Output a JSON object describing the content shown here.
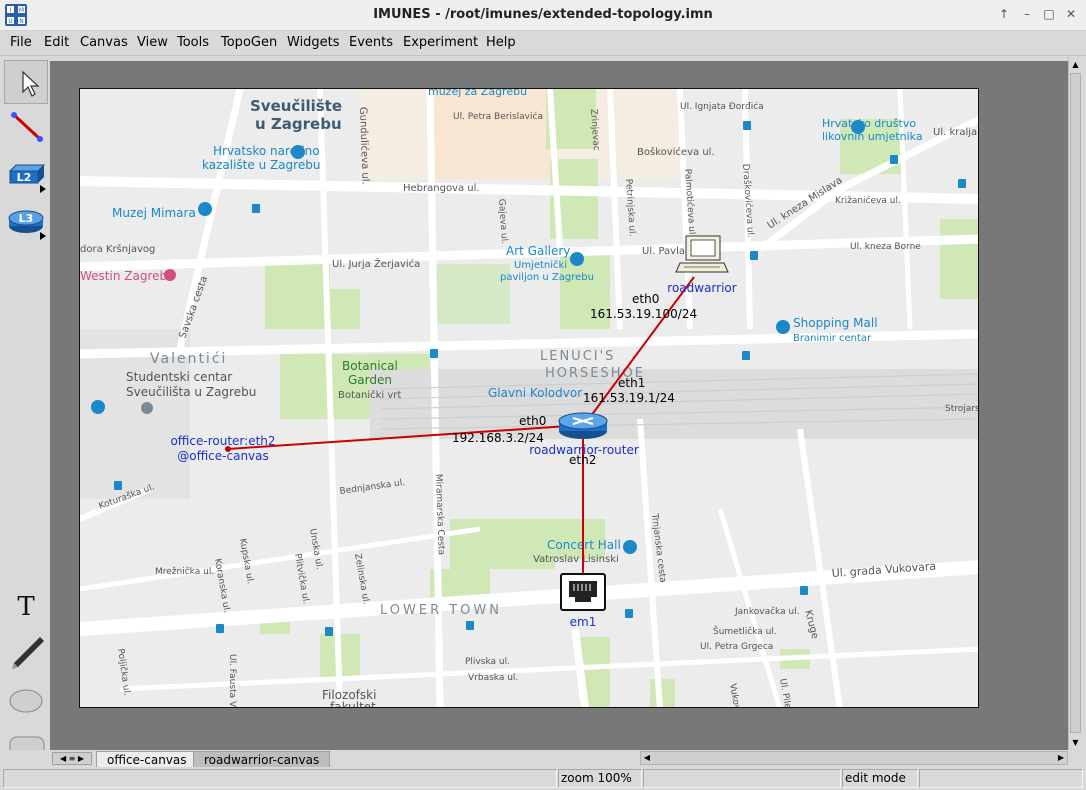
{
  "window": {
    "title": "IMUNES - /root/imunes/extended-topology.imn",
    "app_icon": "imunes-logo-icon",
    "controls": [
      "up-icon",
      "restore-icon",
      "maximize-icon",
      "close-icon"
    ]
  },
  "menubar": {
    "items": [
      {
        "label": "File"
      },
      {
        "label": "Edit"
      },
      {
        "label": "Canvas"
      },
      {
        "label": "View"
      },
      {
        "label": "Tools"
      },
      {
        "label": "TopoGen"
      },
      {
        "label": "Widgets"
      },
      {
        "label": "Events"
      },
      {
        "label": "Experiment"
      },
      {
        "label": "Help"
      }
    ]
  },
  "toolbar": {
    "tools": [
      {
        "name": "select-tool",
        "icon": "pointer-icon"
      },
      {
        "name": "link-tool",
        "icon": "link-icon"
      },
      {
        "name": "l2-tool",
        "icon": "l2-switch-icon",
        "label": "L2"
      },
      {
        "name": "l3-tool",
        "icon": "l3-router-icon",
        "label": "L3"
      },
      {
        "name": "text-tool",
        "icon": "text-icon",
        "label": "T"
      },
      {
        "name": "freeform-tool",
        "icon": "pen-icon"
      },
      {
        "name": "oval-tool",
        "icon": "oval-icon"
      },
      {
        "name": "rectangle-tool",
        "icon": "rectangle-icon"
      }
    ]
  },
  "map": {
    "places": [
      "Sveučilište",
      "u Zagrebu",
      "Hrvatsko narodno",
      "kazalište u Zagrebu",
      "Muzej Mimara",
      "Westin Zagreb",
      "Valentići",
      "Studentski centar",
      "Sveučilišta u Zagrebu",
      "Botanical",
      "Garden",
      "Botanički vrt",
      "Art Gallery",
      "Umjetnički",
      "paviljon u Zagrebu",
      "LENUCI'S",
      "HORSESHOE",
      "Glavni Kolodvor",
      "Shopping Mall",
      "Branimir centar",
      "Concert Hall",
      "Vatroslav Lisinski",
      "LOWER TOWN",
      "Filozofski",
      "fakultet",
      "Hrvatsko društvo",
      "likovnih umjetnika",
      "muzej za Zagrebu"
    ],
    "streets": [
      "Ul. Petra Berislavića",
      "Ul. Ignjata Đorđića",
      "Ul. kralja",
      "Boškovićeva ul.",
      "Hebrangova ul.",
      "Ul. kneza Mislava",
      "Križanićeva ul.",
      "Ul. Pavla",
      "Ul. kneza Borne",
      "Ul. Jurja Žerjavića",
      "dora Kršnjavog",
      "Savska cesta",
      "Ul. grada Vukovara",
      "Ul. Petra Grgeca",
      "Gundulićeva ul.",
      "Miramarska Cesta",
      "Trnjanska cesta",
      "Bednjanska ul.",
      "Koturaška ul.",
      "Kruge",
      "Strojarska",
      "Šumetlička ul.",
      "Jankovačka ul.",
      "Plivska ul.",
      "Vrbaska ul.",
      "Gajeva ul.",
      "Petrinjska ul.",
      "Palmotićeva ul.",
      "Draškovićeva ul.",
      "Zrinjevac",
      "Ul. Fausta Vrančića",
      "Poljička ul.",
      "Mrežnička ul.",
      "Koranska ul.",
      "Kupska ul.",
      "Plitvička ul.",
      "Unska ul.",
      "Zelinska ul.",
      "Vukovarska ul.",
      "Ul. Pile Ruke"
    ]
  },
  "topology": {
    "nodes": {
      "roadwarrior": {
        "label": "roadwarrior",
        "icon": "pc-icon"
      },
      "router": {
        "label": "roadwarrior-router",
        "icon": "router-icon"
      },
      "em1": {
        "label": "em1",
        "icon": "ethernet-port-icon"
      },
      "office_link": {
        "line1": "office-router:eth2",
        "line2": "@office-canvas"
      }
    },
    "labels": {
      "pc_eth0": "eth0",
      "pc_ip": "161.53.19.100/24",
      "router_eth1": "eth1",
      "router_eth1_ip": "161.53.19.1/24",
      "router_eth0": "eth0",
      "router_eth0_ip": "192.168.3.2/24",
      "router_eth2": "eth2"
    },
    "link_color": "#cc0000"
  },
  "tabs": [
    {
      "label": "office-canvas",
      "active": true
    },
    {
      "label": "roadwarrior-canvas",
      "active": false
    }
  ],
  "status": {
    "zoom": "zoom 100%",
    "mode": "edit mode"
  },
  "colors": {
    "map_bg": "#ececec",
    "park": "#cfe8b6",
    "road": "#ffffff",
    "block": "#e0e0e0",
    "label_blue": "#1a2fd4",
    "place_text": "#4a5a6a",
    "poi_blue": "#1a88c9"
  }
}
